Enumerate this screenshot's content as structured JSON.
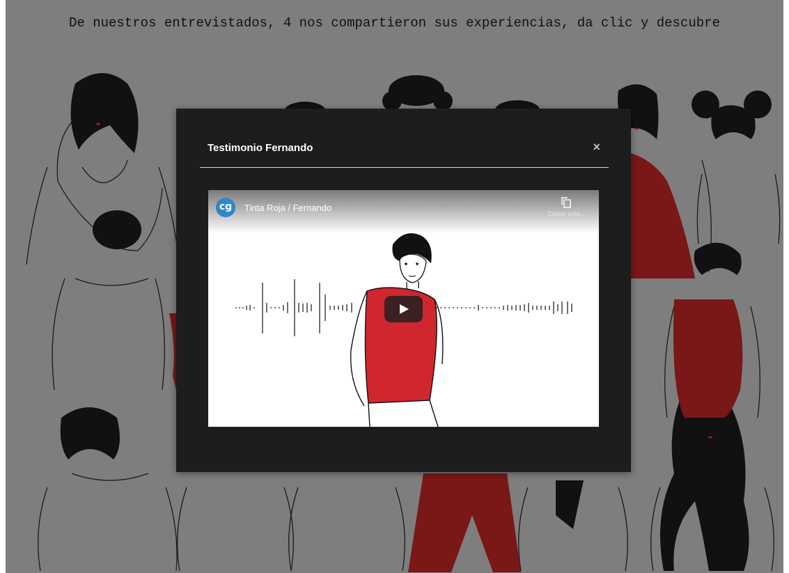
{
  "page": {
    "headline": "De nuestros entrevistados, 4 nos compartieron sus experiencias, da clic y descubre"
  },
  "modal": {
    "title": "Testimonio Fernando",
    "close_label": "×"
  },
  "video": {
    "channel_logo": "cg",
    "title": "Tinta Roja / Fernando",
    "copy_label": "Copiar enla..."
  },
  "icons": {
    "close": "close-icon",
    "copy": "copy-icon",
    "play": "play-icon",
    "channel": "channel-logo"
  },
  "colors": {
    "backdrop": "#7e7e7e",
    "modal_bg": "#1d1d1d",
    "accent_red": "#d0262d",
    "dark_red": "#7a1717",
    "channel_blue": "#2f86c9"
  }
}
